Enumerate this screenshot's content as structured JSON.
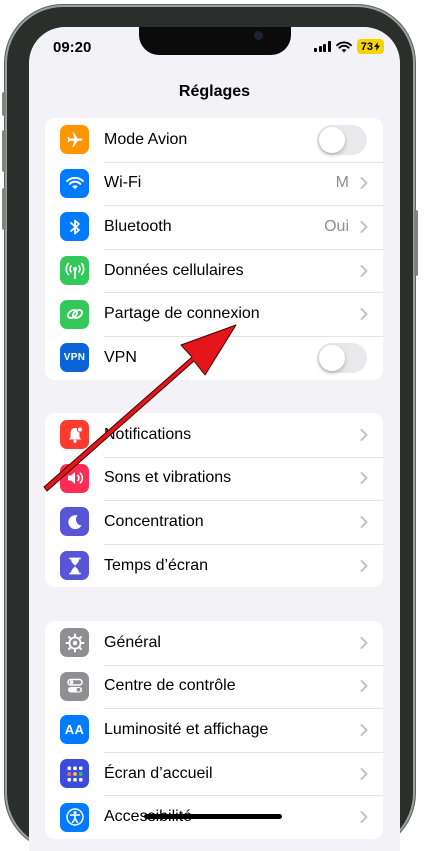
{
  "status_bar": {
    "time": "09:20",
    "battery": "73"
  },
  "header": {
    "title": "Réglages"
  },
  "groups": [
    {
      "items": [
        {
          "label": "Mode Avion",
          "icon": "airplane-icon",
          "color": "#ff9500",
          "control": "toggle",
          "toggle_on": false
        },
        {
          "label": "Wi-Fi",
          "icon": "wifi-icon",
          "color": "#007aff",
          "value": "M",
          "control": "chevron"
        },
        {
          "label": "Bluetooth",
          "icon": "bluetooth-icon",
          "color": "#007aff",
          "value": "Oui",
          "control": "chevron"
        },
        {
          "label": "Données cellulaires",
          "icon": "antenna-icon",
          "color": "#34c759",
          "control": "chevron"
        },
        {
          "label": "Partage de connexion",
          "icon": "chain-link-icon",
          "color": "#34c759",
          "control": "chevron"
        },
        {
          "label": "VPN",
          "icon": "vpn-icon",
          "icon_text": "VPN",
          "color": "#0a64d6",
          "control": "toggle",
          "toggle_on": false
        }
      ]
    },
    {
      "items": [
        {
          "label": "Notifications",
          "icon": "bell-icon",
          "color": "#ff3b30",
          "control": "chevron"
        },
        {
          "label": "Sons et vibrations",
          "icon": "speaker-icon",
          "color": "#ff2d55",
          "control": "chevron"
        },
        {
          "label": "Concentration",
          "icon": "moon-icon",
          "color": "#5856d6",
          "control": "chevron"
        },
        {
          "label": "Temps d’écran",
          "icon": "hourglass-icon",
          "color": "#5856d6",
          "control": "chevron"
        }
      ]
    },
    {
      "items": [
        {
          "label": "Général",
          "icon": "gear-icon",
          "color": "#8e8e93",
          "control": "chevron"
        },
        {
          "label": "Centre de contrôle",
          "icon": "switches-icon",
          "color": "#8e8e93",
          "control": "chevron"
        },
        {
          "label": "Luminosité et affichage",
          "icon": "text-size-icon",
          "icon_text": "AA",
          "color": "#007aff",
          "control": "chevron"
        },
        {
          "label": "Écran d’accueil",
          "icon": "home-grid-icon",
          "color": "#3a4cd8",
          "control": "chevron"
        },
        {
          "label": "Accessibilité",
          "icon": "accessibility-icon",
          "color": "#007aff",
          "control": "chevron"
        }
      ]
    }
  ],
  "annotation": {
    "arrow_color": "#e4161b"
  }
}
